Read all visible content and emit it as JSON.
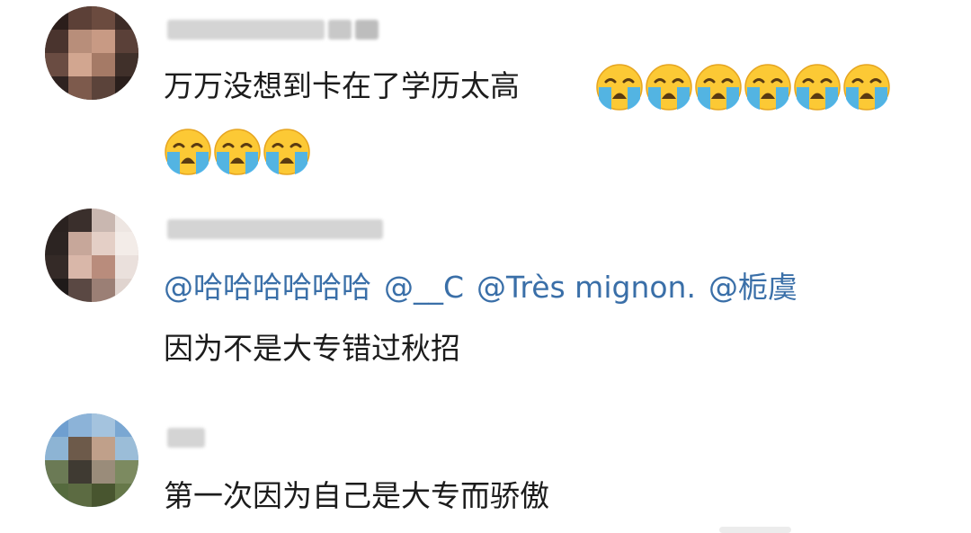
{
  "comments": [
    {
      "username": "",
      "text_line1": "万万没想到卡在了学历太高",
      "emoji_name": "loudly-crying-face-icon",
      "emoji_count": 9
    },
    {
      "username": "",
      "mentions": [
        "@哈哈哈哈哈哈",
        "@__C",
        "@Très mignon.",
        "@栀虞"
      ],
      "text": "因为不是大专错过秋招"
    },
    {
      "username": "",
      "text": "第一次因为自己是大专而骄傲"
    }
  ],
  "colors": {
    "mention": "#3a6fa8",
    "text": "#1c1c1c",
    "blurred_username": "#d4d4d4"
  }
}
